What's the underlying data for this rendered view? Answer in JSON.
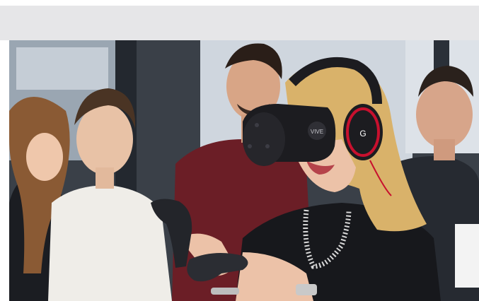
{
  "photo": {
    "subject": "vr-demo",
    "headset_brand_mark": "VIVE",
    "headphone_brand_mark": "G"
  },
  "colors": {
    "header_bar": "#e6e6e8",
    "background_wall": "#3a4048",
    "window_light": "#cfd6de",
    "headset_black": "#1c1c20",
    "headphone_red": "#c8102e",
    "hair_blonde": "#d9b26a",
    "sweater_maroon": "#6b1e26"
  }
}
